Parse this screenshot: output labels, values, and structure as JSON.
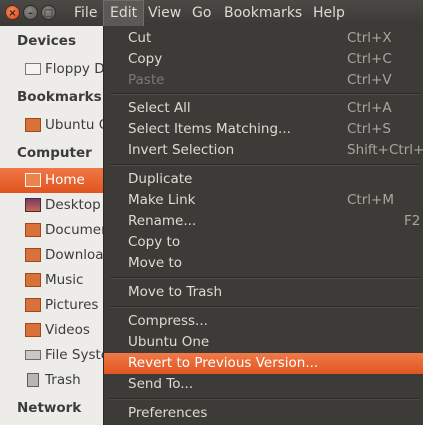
{
  "menubar": {
    "window_buttons": {
      "close": "×",
      "minimize": "–",
      "maximize": "□"
    },
    "items": [
      "File",
      "Edit",
      "View",
      "Go",
      "Bookmarks",
      "Help"
    ],
    "active": "Edit"
  },
  "sidebar": {
    "devices_header": "Devices",
    "devices": [
      {
        "label": "Floppy D",
        "icon": "floppy-drive-icon"
      }
    ],
    "bookmarks_header": "Bookmarks",
    "bookmarks": [
      {
        "label": "Ubuntu O",
        "icon": "folder-icon"
      }
    ],
    "computer_header": "Computer",
    "computer": [
      {
        "label": "Home",
        "icon": "home-folder-icon",
        "selected": true
      },
      {
        "label": "Desktop",
        "icon": "desktop-icon"
      },
      {
        "label": "Documen",
        "icon": "documents-folder-icon"
      },
      {
        "label": "Downloa",
        "icon": "downloads-folder-icon"
      },
      {
        "label": "Music",
        "icon": "music-folder-icon"
      },
      {
        "label": "Pictures",
        "icon": "pictures-folder-icon"
      },
      {
        "label": "Videos",
        "icon": "videos-folder-icon"
      },
      {
        "label": "File Syste",
        "icon": "file-system-icon"
      },
      {
        "label": "Trash",
        "icon": "trash-icon"
      }
    ],
    "network_header": "Network"
  },
  "edit_menu": {
    "items": [
      {
        "label": "Cut",
        "accel": "Ctrl+X"
      },
      {
        "label": "Copy",
        "accel": "Ctrl+C"
      },
      {
        "label": "Paste",
        "accel": "Ctrl+V",
        "disabled": true
      },
      {
        "label": "Select All",
        "accel": "Ctrl+A"
      },
      {
        "label": "Select Items Matching...",
        "accel": "Ctrl+S"
      },
      {
        "label": "Invert Selection",
        "accel": "Shift+Ctrl+I"
      },
      {
        "label": "Duplicate",
        "accel": ""
      },
      {
        "label": "Make Link",
        "accel": "Ctrl+M"
      },
      {
        "label": "Rename...",
        "accel": "F2"
      },
      {
        "label": "Copy to",
        "accel": ""
      },
      {
        "label": "Move to",
        "accel": ""
      },
      {
        "label": "Move to Trash",
        "accel": ""
      },
      {
        "label": "Compress...",
        "accel": ""
      },
      {
        "label": "Ubuntu One",
        "accel": ""
      },
      {
        "label": "Revert to Previous Version...",
        "accel": "",
        "highlighted": true
      },
      {
        "label": "Send To...",
        "accel": ""
      },
      {
        "label": "Preferences",
        "accel": ""
      }
    ]
  },
  "colors": {
    "accent": "#e8622c",
    "menu_bg": "#3c3b37",
    "sidebar_bg": "#edece9"
  }
}
